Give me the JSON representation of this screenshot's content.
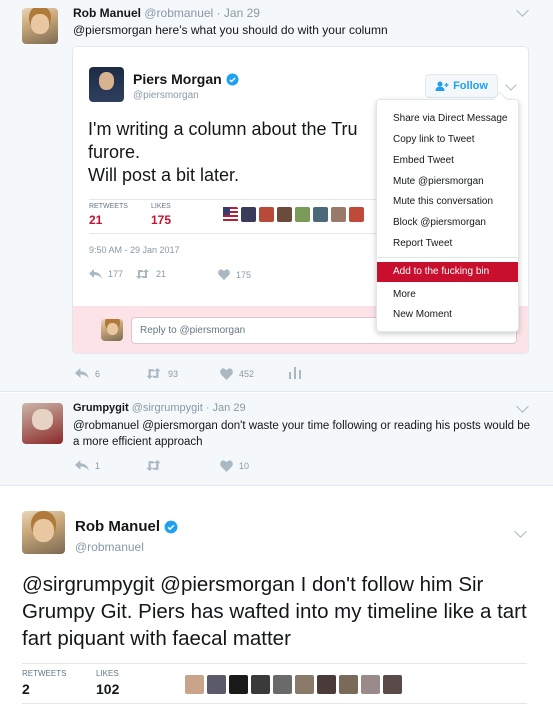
{
  "tweet1": {
    "author_name": "Rob Manuel",
    "author_handle": "@robmanuel",
    "date": "· Jan 29",
    "text": "@piersmorgan here's what you should do with your column",
    "actions": {
      "replies": "6",
      "retweets": "93",
      "likes": "452"
    }
  },
  "embedded": {
    "author_name": "Piers Morgan",
    "author_handle": "@piersmorgan",
    "follow_label": "Follow",
    "text_line1": "I'm writing a column about the Tru",
    "text_line2": "furore.",
    "text_line3": "Will post a bit later.",
    "retweets_label": "RETWEETS",
    "retweets_count": "21",
    "likes_label": "LIKES",
    "likes_count": "175",
    "timestamp": "9:50 AM - 29 Jan 2017",
    "actions": {
      "replies": "177",
      "retweets": "21",
      "likes": "175"
    },
    "reply_placeholder": "Reply to @piersmorgan"
  },
  "menu": {
    "items": [
      "Share via Direct Message",
      "Copy link to Tweet",
      "Embed Tweet",
      "Mute @piersmorgan",
      "Mute this conversation",
      "Block @piersmorgan",
      "Report Tweet"
    ],
    "highlighted": "Add to the fucking bin",
    "more": "More",
    "new_moment": "New Moment",
    "highlight_color": "#c8102e"
  },
  "tweet2": {
    "author_name": "Grumpygit",
    "author_handle": "@sirgrumpygit",
    "date": "· Jan 29",
    "text": "@robmanuel @piersmorgan don't waste your time following or reading his posts would be a more efficient approach",
    "actions": {
      "replies": "1",
      "likes": "10"
    }
  },
  "tweet3": {
    "author_name": "Rob Manuel",
    "author_handle": "@robmanuel",
    "text": "@sirgrumpygit @piersmorgan I don't follow him Sir Grumpy Git. Piers has wafted into my timeline like a tart fart piquant with faecal matter",
    "retweets_label": "RETWEETS",
    "retweets_count": "2",
    "likes_label": "LIKES",
    "likes_count": "102"
  },
  "colors": {
    "verified": "#1da1f2",
    "link": "#1da1f2",
    "reply_bar": "#fbe3e8"
  },
  "icons": [
    "reply-icon",
    "retweet-icon",
    "heart-icon",
    "analytics-icon",
    "chevron-down-icon",
    "verified-icon",
    "follow-person-icon"
  ]
}
